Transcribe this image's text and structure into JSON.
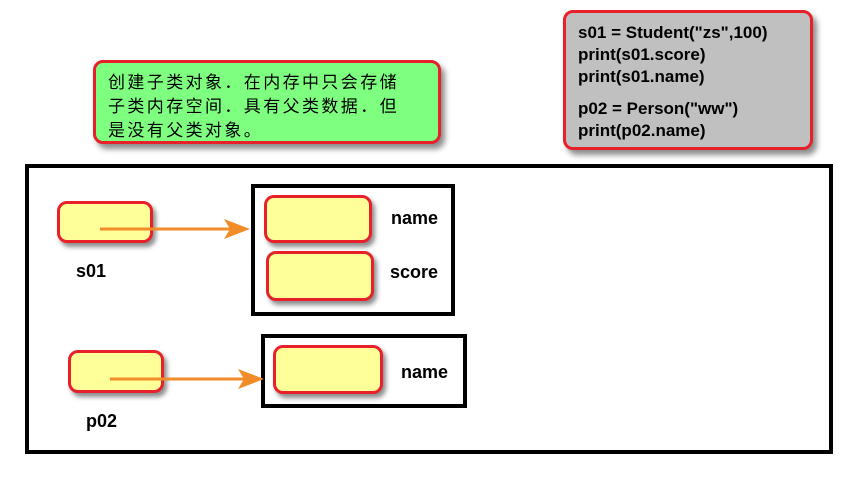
{
  "note": {
    "lines": [
      "创建子类对象．在内存中只会存储",
      "子类内存空间．具有父类数据．但",
      "是没有父类对象。"
    ]
  },
  "code": {
    "lines": [
      "s01 = Student(\"zs\",100)",
      "print(s01.score)",
      "print(s01.name)",
      "p02 = Person(\"ww\")",
      "print(p02.name)"
    ]
  },
  "diagram": {
    "s01_label": "s01",
    "p02_label": "p02",
    "student_object": {
      "fields": [
        "name",
        "score"
      ]
    },
    "person_object": {
      "fields": [
        "name"
      ]
    }
  },
  "colors": {
    "note_bg": "#7fff7f",
    "code_bg": "#c0c0c0",
    "slot_fill": "#ffff99",
    "border_red": "#e8202a",
    "arrow": "#f28c28"
  }
}
